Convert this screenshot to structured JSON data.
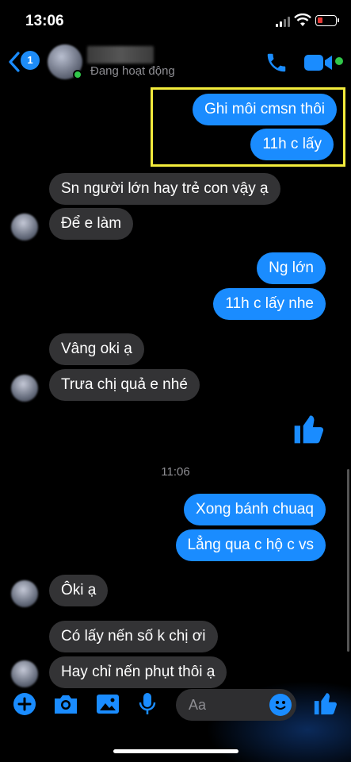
{
  "status_bar": {
    "time": "13:06"
  },
  "header": {
    "back_badge": "1",
    "status": "Đang hoạt động"
  },
  "messages": {
    "m1": "Ghi môi cmsn thôi",
    "m2": "11h c lấy",
    "m3": "Sn người lớn hay trẻ con vậy ạ",
    "m4": "Để e làm",
    "m5": "Ng lớn",
    "m6": "11h c lấy nhe",
    "m7": "Vâng oki ạ",
    "m8": "Trưa chị quả e nhé",
    "timestamp": "11:06",
    "m9": "Xong bánh chuaq",
    "m10": "Lẳng qua c hộ c vs",
    "m11": "Ôki ạ",
    "m12": "Có lấy nến số k chị ơi",
    "m13": "Hay chỉ nến phụt thôi ạ"
  },
  "composer": {
    "placeholder": "Aa"
  },
  "colors": {
    "accent": "#1a8cff",
    "incoming": "#333335",
    "highlight": "#f3ec3c",
    "online": "#31c74a"
  }
}
